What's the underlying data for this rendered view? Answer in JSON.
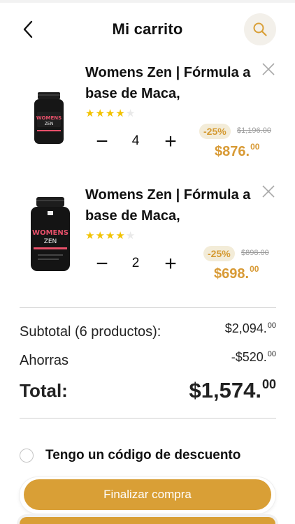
{
  "header": {
    "title": "Mi carrito",
    "back_icon": "chevron-left-icon",
    "search_icon": "search-icon"
  },
  "items": [
    {
      "name": "Womens Zen | Fórmula a base de Maca,",
      "rating": 4,
      "rating_max": 5,
      "quantity": "4",
      "discount": "-25%",
      "old_price": "$1,196.00",
      "price_main": "$876.",
      "price_cents": "00"
    },
    {
      "name": "Womens Zen | Fórmula a base de Maca,",
      "rating": 4,
      "rating_max": 5,
      "quantity": "2",
      "discount": "-25%",
      "old_price": "$898.00",
      "price_main": "$698.",
      "price_cents": "00"
    }
  ],
  "qty_controls": {
    "minus": "−",
    "plus": "+"
  },
  "summary": {
    "subtotal_label": "Subtotal (6 productos):",
    "subtotal_main": "$2,094.",
    "subtotal_cents": "00",
    "savings_label": "Ahorras",
    "savings_main": "-$520.",
    "savings_cents": "00",
    "total_label": "Total:",
    "total_main": "$1,574.",
    "total_cents": "00"
  },
  "coupon": {
    "label": "Tengo un código de descuento"
  },
  "checkout": {
    "label": "Finalizar compra"
  },
  "colors": {
    "accent": "#d99f36",
    "price": "#d89a35",
    "badge_bg": "#f3ecd8",
    "star": "#f2c200"
  }
}
